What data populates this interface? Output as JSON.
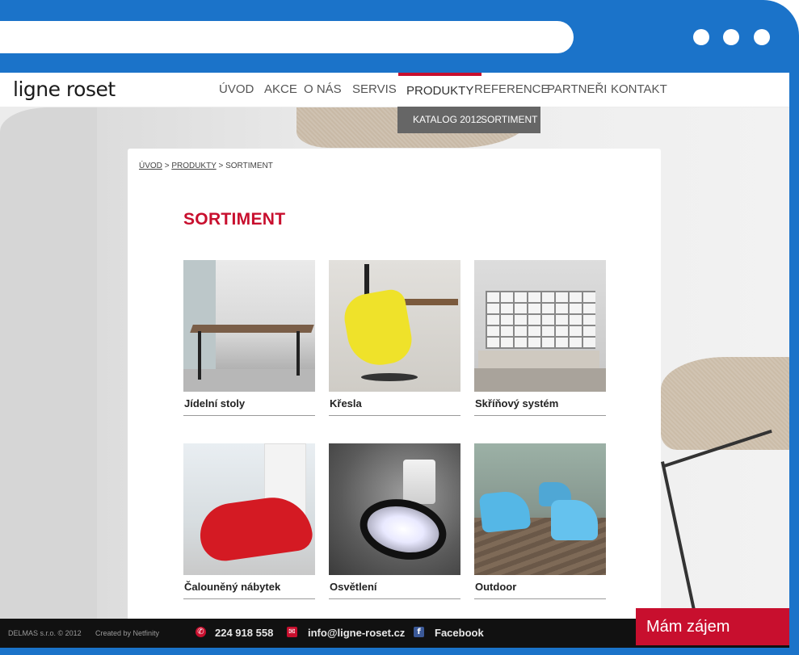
{
  "browser": {
    "window_controls": [
      "dot-1",
      "dot-2",
      "dot-3"
    ]
  },
  "brand": {
    "logo_text": "ligne roset",
    "accent_color": "#c80f2e"
  },
  "nav": {
    "items": [
      "ÚVOD",
      "AKCE",
      "O NÁS",
      "SERVIS",
      "PRODUKTY",
      "REFERENCE",
      "PARTNEŘI",
      "KONTAKT"
    ],
    "active": "PRODUKTY",
    "subitems": [
      "KATALOG 2012",
      "SORTIMENT"
    ]
  },
  "breadcrumb": {
    "items": [
      "ÚVOD",
      "PRODUKTY",
      "SORTIMENT"
    ],
    "separator": ">"
  },
  "main": {
    "title": "SORTIMENT",
    "categories": [
      {
        "label": "Jídelní stoly",
        "image": "dining-table-image"
      },
      {
        "label": "Křesla",
        "image": "armchair-image"
      },
      {
        "label": "Skříňový systém",
        "image": "shelving-system-image"
      },
      {
        "label": "Čalouněný nábytek",
        "image": "upholstered-sofa-image"
      },
      {
        "label": "Osvětlení",
        "image": "lighting-image"
      },
      {
        "label": "Outdoor",
        "image": "outdoor-chairs-image"
      }
    ]
  },
  "footer": {
    "company": "DELMAS s.r.o. © 2012",
    "credit": "Created by Netfinity",
    "phone": "224 918 558",
    "email": "info@ligne-roset.cz",
    "facebook": "Facebook"
  },
  "cta": {
    "label": "Mám zájem"
  }
}
